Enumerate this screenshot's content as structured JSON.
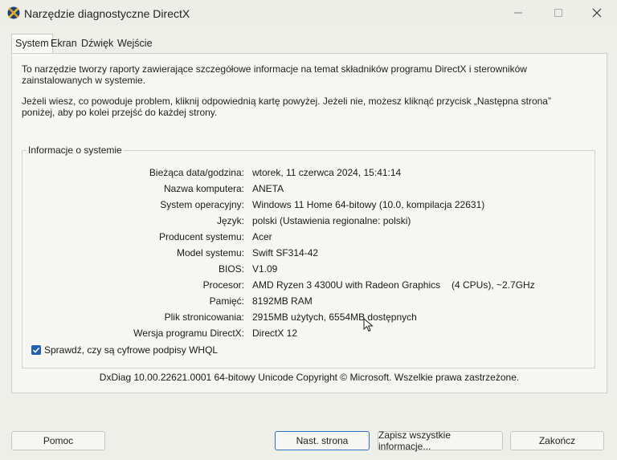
{
  "window": {
    "title": "Narzędzie diagnostyczne DirectX"
  },
  "tabs": [
    {
      "label": "System",
      "active": true
    },
    {
      "label": "Ekran",
      "active": false
    },
    {
      "label": "Dźwięk",
      "active": false
    },
    {
      "label": "Wejście",
      "active": false
    }
  ],
  "intro": {
    "p1": "To narzędzie tworzy raporty zawierające szczegółowe informacje na temat składników programu DirectX i sterowników zainstalowanych w systemie.",
    "p2": "Jeżeli wiesz, co powoduje problem, kliknij odpowiednią kartę powyżej. Jeżeli nie, możesz kliknąć przycisk „Następna strona” poniżej, aby po kolei przejść do każdej strony."
  },
  "system_info": {
    "group_title": "Informacje o systemie",
    "rows": [
      {
        "label": "Bieżąca data/godzina:",
        "value": "wtorek, 11 czerwca 2024, 15:41:14"
      },
      {
        "label": "Nazwa komputera:",
        "value": "ANETA"
      },
      {
        "label": "System operacyjny:",
        "value": "Windows 11 Home 64-bitowy (10.0, kompilacja 22631)"
      },
      {
        "label": "Język:",
        "value": "polski (Ustawienia regionalne: polski)"
      },
      {
        "label": "Producent systemu:",
        "value": "Acer"
      },
      {
        "label": "Model systemu:",
        "value": "Swift SF314-42"
      },
      {
        "label": "BIOS:",
        "value": "V1.09"
      },
      {
        "label": "Procesor:",
        "value": "AMD Ryzen 3 4300U with Radeon Graphics",
        "value2": "(4 CPUs), ~2.7GHz"
      },
      {
        "label": "Pamięć:",
        "value": "8192MB RAM"
      },
      {
        "label": "Plik stronicowania:",
        "value": "2915MB użytych, 6554MB dostępnych"
      },
      {
        "label": "Wersja programu DirectX:",
        "value": "DirectX 12"
      }
    ]
  },
  "whql": {
    "label": "Sprawdź, czy są cyfrowe podpisy WHQL",
    "checked": true
  },
  "footer": {
    "text": "DxDiag 10.00.22621.0001 64-bitowy Unicode  Copyright © Microsoft. Wszelkie prawa zastrzeżone."
  },
  "buttons": {
    "help": "Pomoc",
    "next": "Nast. strona",
    "save": "Zapisz wszystkie informacje...",
    "exit": "Zakończ"
  },
  "colors": {
    "accent": "#1f5fb8",
    "background": "#efefea"
  }
}
